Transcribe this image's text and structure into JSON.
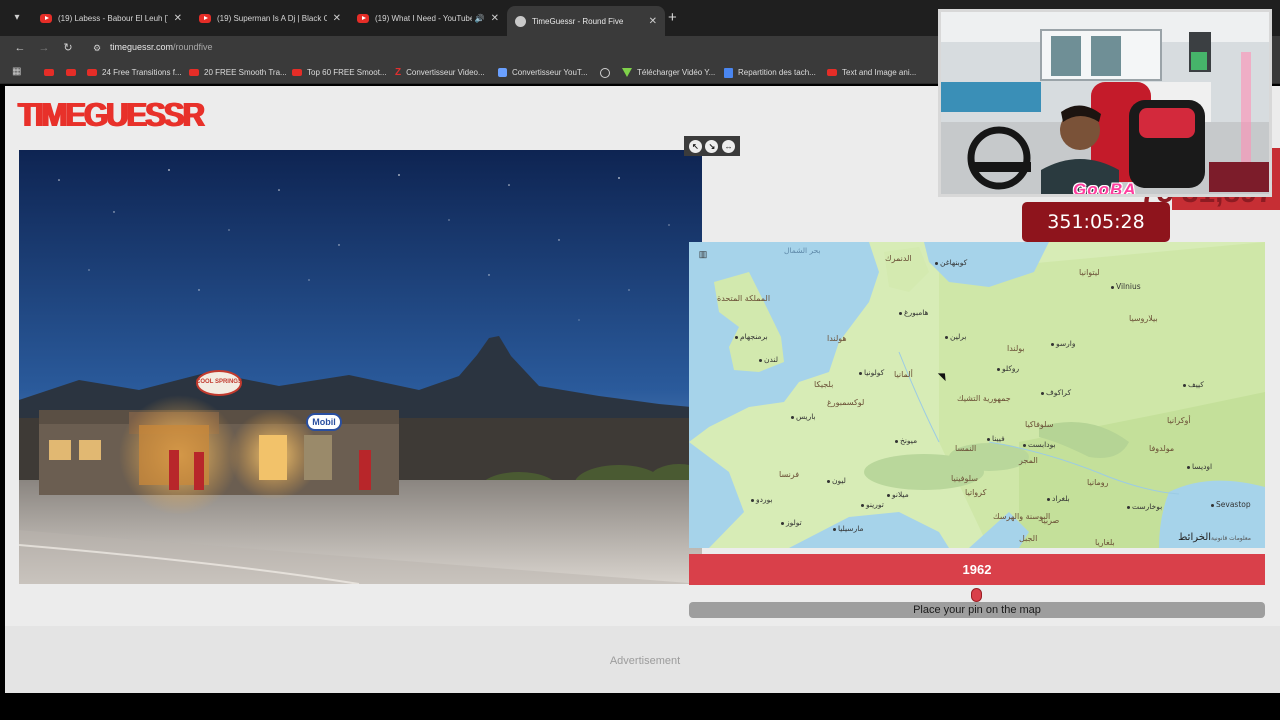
{
  "browser": {
    "tabs": [
      {
        "title": "(19) Labess - Babour El Leuh [T",
        "icon": "youtube-icon",
        "active": false
      },
      {
        "title": "(19) Superman Is A Dj | Black C",
        "icon": "youtube-icon",
        "active": false
      },
      {
        "title": "(19) What I Need - YouTube",
        "icon": "youtube-icon",
        "active": false,
        "audio": true
      },
      {
        "title": "TimeGuessr - Round Five",
        "icon": "globe-icon",
        "active": true
      }
    ],
    "url_host": "timeguessr.com",
    "url_path": "/roundfive",
    "bookmarks": [
      "",
      "",
      "24 Free Transitions f...",
      "20 FREE Smooth Tra...",
      "Top 60 FREE Smoot...",
      "Convertisseur Video...",
      "Convertisseur YouT...",
      "",
      "Télécharger Vidéo Y...",
      "Repartition des tach...",
      "Text and Image ani..."
    ]
  },
  "page": {
    "logo": "TIMEGUESSR",
    "year": "1962",
    "slider_fraction": 0.498,
    "place_pin": "Place your pin on the map",
    "advertisement": "Advertisement"
  },
  "photo": {
    "sign_cool_springs": "COOL SPRINGS",
    "sign_mobil": "Mobil"
  },
  "overlay": {
    "timer": "351:05:28",
    "score": "75 31,897",
    "cam_name": "GooBA"
  },
  "map": {
    "attribution": "الخرائط",
    "attribution_small": "معلومات قانونية",
    "labels": {
      "north_sea": "بحر الشمال",
      "uk": "المملكة المتحدة",
      "denmark": "الدنمرك",
      "copenhagen": "كوبنهاغن",
      "lithuania": "ليتوانيا",
      "vilnius": "Vilnius",
      "birmingham": "برمنجهام",
      "hamburg": "هامبورغ",
      "berlin": "برلين",
      "poland": "بولندا",
      "warsaw": "وارسو",
      "belarus": "بيلاروسيا",
      "london": "لندن",
      "netherlands": "هولندا",
      "cologne": "كولونيا",
      "germany": "ألمانيا",
      "wroclaw": "روكلو",
      "belgium": "بلجيكا",
      "luxembourg": "لوكسمبورغ",
      "czech": "جمهورية التشيك",
      "krakow": "كراكوف",
      "kyiv": "كييف",
      "ukraine": "أوكرانيا",
      "paris": "باريس",
      "slovakia": "سلوفاكيا",
      "munich": "ميونخ",
      "vienna": "فيينا",
      "budapest": "بودابست",
      "moldova": "مولدوفا",
      "austria": "النمسا",
      "hungary": "المجر",
      "odesa": "اوديسا",
      "france": "فرنسا",
      "lyon": "ليون",
      "slovenia": "سلوفينيا",
      "romania": "رومانيا",
      "bordeaux": "بوردو",
      "milan": "ميلانو",
      "croatia": "كرواتيا",
      "belgrade": "بلغراد",
      "bucharest": "بوخارست",
      "sevastopol": "Sevastop",
      "toulouse": "تولوز",
      "marseille": "مارسيليا",
      "bosnia": "البوسنة والهرسك",
      "serbia": "صربيا",
      "bulgaria": "بلغاريا",
      "turin": "تورينو",
      "montenegro": "الجبل"
    }
  }
}
